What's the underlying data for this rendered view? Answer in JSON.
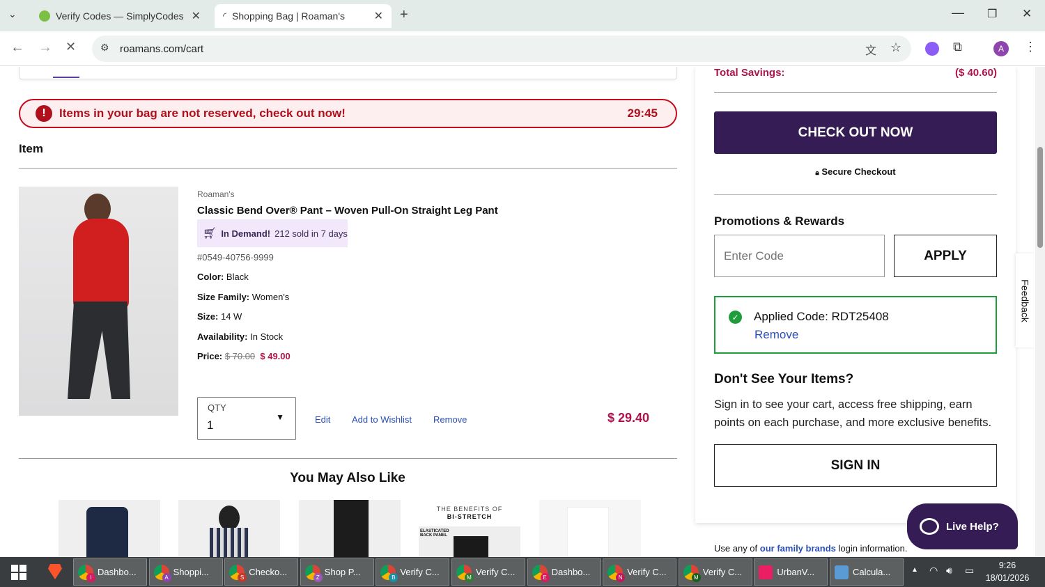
{
  "browser": {
    "tabs": [
      {
        "title": "Verify Codes — SimplyCodes",
        "active": false
      },
      {
        "title": "Shopping Bag | Roaman's",
        "active": true
      }
    ],
    "url": "roamans.com/cart",
    "profile_initial": "A"
  },
  "alert": {
    "message": "Items in your bag are not reserved, check out now!",
    "timer": "29:45",
    "icon": "exclamation-icon"
  },
  "cart": {
    "column_header": "Item",
    "item": {
      "brand": "Roaman's",
      "name": "Classic Bend Over® Pant – Woven Pull-On Straight Leg Pant",
      "demand_label": "In Demand!",
      "demand_text": "212 sold in 7 days",
      "sku": "#0549-40756-9999",
      "color_label": "Color:",
      "color": "Black",
      "size_family_label": "Size Family:",
      "size_family": "Women's",
      "size_label": "Size:",
      "size": "14 W",
      "availability_label": "Availability:",
      "availability": "In Stock",
      "price_label": "Price:",
      "original_price": "$ 70.00",
      "sale_price": "$ 49.00",
      "qty_label": "QTY",
      "qty": "1",
      "edit": "Edit",
      "wishlist": "Add to Wishlist",
      "remove": "Remove",
      "line_total": "$ 29.40"
    }
  },
  "recommendations": {
    "title": "You May Also Like",
    "banner_line1": "THE BENEFITS OF",
    "banner_line2": "BI-STRETCH",
    "banner_label": "ELASTICATED BACK PANEL"
  },
  "summary": {
    "savings_label": "Total Savings:",
    "savings_value": "($ 40.60)",
    "checkout": "CHECK OUT NOW",
    "secure": "Secure Checkout",
    "promo_title": "Promotions & Rewards",
    "promo_placeholder": "Enter Code",
    "apply": "APPLY",
    "applied_code": "Applied Code: RDT25408",
    "remove": "Remove",
    "signin_title": "Don't See Your Items?",
    "signin_text": "Sign in to see your cart, access free shipping, earn points on each purchase, and more exclusive benefits.",
    "signin_button": "SIGN IN",
    "family_prefix": "Use any of",
    "family_link": "our family brands",
    "family_suffix": "login information."
  },
  "feedback": "Feedback",
  "live_help": "Live Help?",
  "taskbar": {
    "items": [
      {
        "label": "Dashbo...",
        "badge": "I",
        "color": "#d81b60"
      },
      {
        "label": "Shoppi...",
        "badge": "A",
        "color": "#8e44ad"
      },
      {
        "label": "Checko...",
        "badge": "S",
        "color": "#c0392b"
      },
      {
        "label": "Shop P...",
        "badge": "Z",
        "color": "#9b59b6"
      },
      {
        "label": "Verify C...",
        "badge": "B",
        "color": "#1a8fa8"
      },
      {
        "label": "Verify C...",
        "badge": "M",
        "color": "#2e7d32"
      },
      {
        "label": "Dashbo...",
        "badge": "E",
        "color": "#d81b60"
      },
      {
        "label": "Verify C...",
        "badge": "N",
        "color": "#c2185b"
      },
      {
        "label": "Verify C...",
        "badge": "M",
        "color": "#1b5e20"
      },
      {
        "label": "UrbanV...",
        "badge": "",
        "color": "#e91e63"
      },
      {
        "label": "Calcula...",
        "badge": "",
        "color": "#5b9bd5"
      }
    ],
    "time": "9:26",
    "date": "18/01/2026"
  },
  "colors": {
    "accent": "#351c55",
    "sale": "#b0134b",
    "alert": "#c40d1e",
    "link": "#2a4fb8",
    "success": "#1e9e3a"
  }
}
